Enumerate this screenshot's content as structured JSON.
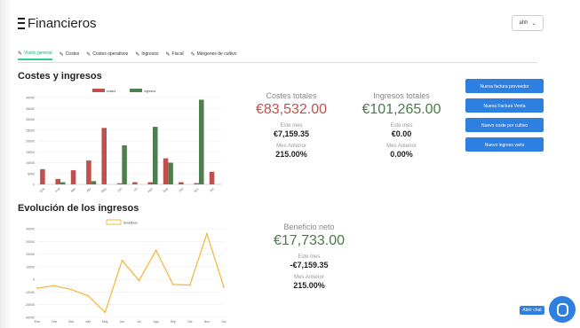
{
  "app": {
    "title": "Financieros",
    "user_select": "ahh"
  },
  "tabs": [
    {
      "label": "Visión general",
      "active": true
    },
    {
      "label": "Costes",
      "active": false
    },
    {
      "label": "Costes operativos",
      "active": false
    },
    {
      "label": "Ingresos",
      "active": false
    },
    {
      "label": "Fiscal",
      "active": false
    },
    {
      "label": "Márgenes de cultivo",
      "active": false
    }
  ],
  "section1": {
    "title": "Costes y ingresos",
    "costs": {
      "label": "Costes totales",
      "value": "€83,532.00",
      "month_label": "Este mes",
      "month_value": "€7,159.35",
      "prev_label": "Mes Anterior",
      "prev_value": "215.00%"
    },
    "income": {
      "label": "Ingresos totales",
      "value": "€101,265.00",
      "month_label": "Este mes",
      "month_value": "€0.00",
      "prev_label": "Mes Anterior",
      "prev_value": "0.00%"
    }
  },
  "buttons": [
    {
      "label": "Nueva factura proveedor"
    },
    {
      "label": "Nueva Factura Venta"
    },
    {
      "label": "Nuevo coste por cultivo"
    },
    {
      "label": "Nuevo ingreso vario"
    }
  ],
  "section2": {
    "title": "Evolución de los ingresos",
    "profit": {
      "label": "Beneficio neto",
      "value": "€17,733.00",
      "month_label": "Este mes",
      "month_value": "-€7,159.35",
      "prev_label": "Mes Anterior",
      "prev_value": "215.00%"
    }
  },
  "chat": {
    "chip_label": "Abrir chat"
  },
  "colors": {
    "red": "#c0504d",
    "green": "#4f7f4f",
    "blue": "#2d7fe0",
    "line": "#f5b942"
  },
  "chart_data": [
    {
      "type": "bar",
      "legend": [
        "costes",
        "ingresos"
      ],
      "legend_position": "top",
      "categories": [
        "Ene",
        "Feb",
        "Mar",
        "Abr",
        "May",
        "Jun",
        "Jul",
        "Ago",
        "Sep",
        "Oct",
        "Nov",
        "Dic"
      ],
      "series": [
        {
          "name": "costes",
          "color": "#c0504d",
          "values": [
            7000,
            2500,
            6500,
            11000,
            26000,
            500,
            1000,
            1000,
            12000,
            1000,
            600,
            5800
          ]
        },
        {
          "name": "ingresos",
          "color": "#4f7f4f",
          "values": [
            0,
            1000,
            0,
            1500,
            0,
            18000,
            0,
            26500,
            10000,
            0,
            39000,
            0
          ]
        }
      ],
      "ylim": [
        0,
        40000
      ],
      "grid": true
    },
    {
      "type": "line",
      "legend": [
        "beneficios"
      ],
      "legend_position": "top",
      "categories": [
        "Ene",
        "Feb",
        "Mar",
        "Abr",
        "May",
        "Jun",
        "Jul",
        "Ago",
        "Sep",
        "Oct",
        "Nov",
        "Dic"
      ],
      "series": [
        {
          "name": "beneficios",
          "color": "#f5b942",
          "values": [
            -7000,
            -5000,
            -8000,
            -13000,
            -26000,
            15000,
            -1000,
            23000,
            -4000,
            -4500,
            36000,
            -6000
          ]
        }
      ],
      "ylim": [
        -30000,
        40000
      ],
      "grid": true
    }
  ]
}
